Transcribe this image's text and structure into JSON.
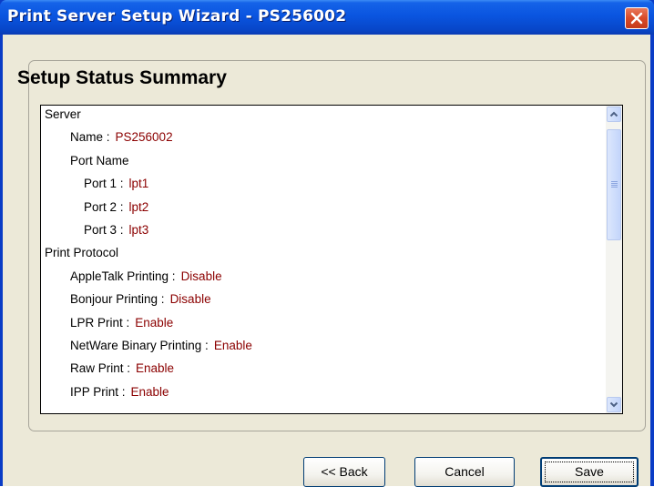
{
  "window": {
    "title": "Print Server Setup Wizard - PS256002",
    "close_icon": "close-icon"
  },
  "page": {
    "heading": "Setup Status Summary"
  },
  "summary": {
    "rows": [
      {
        "label": "Server",
        "value": "",
        "indent": 0
      },
      {
        "label": "Name :",
        "value": "PS256002",
        "indent": 1
      },
      {
        "label": "Port Name",
        "value": "",
        "indent": 1
      },
      {
        "label": "Port 1 :",
        "value": "lpt1",
        "indent": 2
      },
      {
        "label": "Port 2 :",
        "value": "lpt2",
        "indent": 2
      },
      {
        "label": "Port 3 :",
        "value": "lpt3",
        "indent": 2
      },
      {
        "label": "Print Protocol",
        "value": "",
        "indent": 0
      },
      {
        "label": "AppleTalk Printing :",
        "value": "Disable",
        "indent": 1
      },
      {
        "label": "Bonjour Printing :",
        "value": "Disable",
        "indent": 1
      },
      {
        "label": "LPR Print :",
        "value": "Enable",
        "indent": 1
      },
      {
        "label": "NetWare Binary Printing :",
        "value": "Enable",
        "indent": 1
      },
      {
        "label": "Raw Print :",
        "value": "Enable",
        "indent": 1
      },
      {
        "label": "IPP Print :",
        "value": "Enable",
        "indent": 1
      }
    ]
  },
  "buttons": {
    "back": "<< Back",
    "cancel": "Cancel",
    "save": "Save"
  },
  "colors": {
    "value_text": "#8b0000",
    "titlebar": "#0a55e0",
    "dialog_bg": "#ece9d8"
  }
}
